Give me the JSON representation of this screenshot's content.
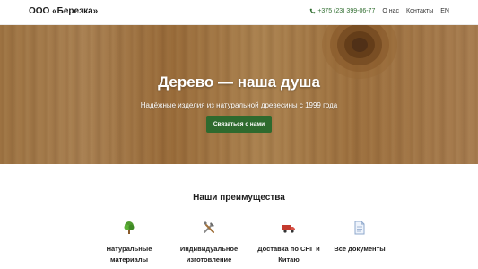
{
  "header": {
    "logo": "ООО «Березка»",
    "phone": "+375 (23) 399-06-77",
    "nav": [
      "О нас",
      "Контакты",
      "EN"
    ]
  },
  "hero": {
    "title": "Дерево — наша душа",
    "subtitle": "Надёжные изделия из натуральной древесины с 1999 года",
    "cta": "Связаться с нами"
  },
  "features": {
    "title": "Наши преимущества",
    "items": [
      {
        "icon": "tree-icon",
        "label": "Натуральные материалы"
      },
      {
        "icon": "tools-icon",
        "label": "Индивидуальное изготовление"
      },
      {
        "icon": "truck-icon",
        "label": "Доставка по СНГ и Китаю"
      },
      {
        "icon": "document-icon",
        "label": "Все документы"
      }
    ]
  },
  "colors": {
    "accent": "#2e6a2e",
    "phone": "#2f6d2f",
    "wood": "#c08f58"
  }
}
